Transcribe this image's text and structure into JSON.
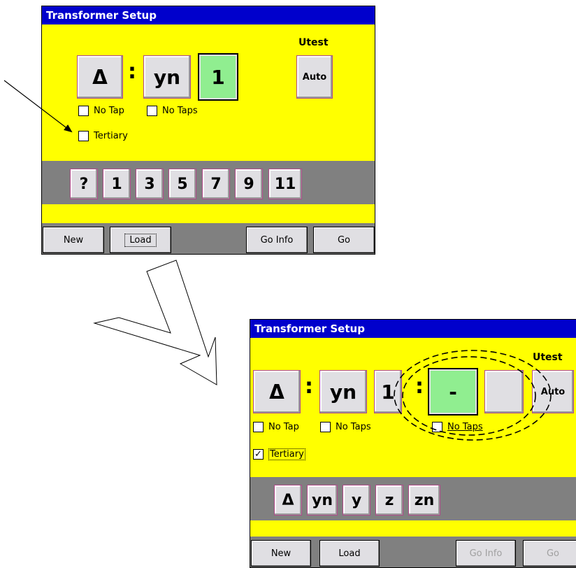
{
  "screen1": {
    "title": "Transformer Setup",
    "utest_label": "Utest",
    "auto_label": "Auto",
    "vector_group": [
      "Δ",
      ":",
      "yn",
      "1"
    ],
    "checkboxes": [
      {
        "label": "No Tap",
        "checked": false
      },
      {
        "label": "No Taps",
        "checked": false
      },
      {
        "label": "Tertiary",
        "checked": false
      }
    ],
    "selector_buttons": [
      "?",
      "1",
      "3",
      "5",
      "7",
      "9",
      "11"
    ],
    "bottom_buttons": [
      "New",
      "Load",
      "Go Info",
      "Go"
    ]
  },
  "screen2": {
    "title": "Transformer Setup",
    "utest_label": "Utest",
    "auto_label": "Auto",
    "vector_group": [
      "Δ",
      ":",
      "yn",
      "1",
      ":",
      "-",
      ""
    ],
    "checkboxes": [
      {
        "label": "No Tap",
        "checked": false
      },
      {
        "label": "No Taps",
        "checked": false
      },
      {
        "label": "No Taps",
        "checked": false
      },
      {
        "label": "Tertiary",
        "checked": true,
        "check_mark": "✓"
      }
    ],
    "selector_buttons": [
      "Δ",
      "yn",
      "y",
      "z",
      "zn"
    ],
    "bottom_buttons": [
      "New",
      "Load",
      "Go Info",
      "Go"
    ]
  },
  "colors": {
    "window_bg": "#ffff00",
    "title_bg": "#0000cc",
    "selected_bg": "#90ee90",
    "strip_bg": "#808080"
  }
}
